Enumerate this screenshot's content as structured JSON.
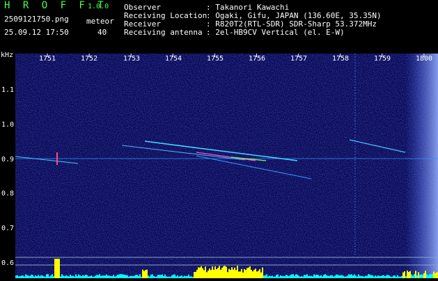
{
  "app": {
    "title": "H R O F F T",
    "version": "1.0.0",
    "filename": "2509121750.png",
    "datetime": "25.09.12 17:50",
    "meteor_label": "meteor",
    "meteor_count": "40"
  },
  "info": {
    "rows": [
      {
        "label": "Observer",
        "value": ": Takanori Kawachi"
      },
      {
        "label": "Receiving Location",
        "value": ": Ogaki, Gifu, JAPAN (136.60E, 35.35N)"
      },
      {
        "label": "Receiver",
        "value": ": R820T2(RTL-SDR) SDR-Sharp 53.372MHz"
      },
      {
        "label": "Receiving antenna",
        "value": ": 2el-HB9CV Vertical (el. E-W)"
      }
    ]
  },
  "axis": {
    "y_unit": "kHz",
    "x_ticks": [
      "1751",
      "1752",
      "1753",
      "1754",
      "1755",
      "1756",
      "1757",
      "1758",
      "1759",
      "1800"
    ],
    "y_ticks": [
      "1.1",
      "1.0",
      "0.9",
      "0.8",
      "0.7",
      "0.6"
    ]
  },
  "colors": {
    "background": "#0a0a50",
    "text": "#4cff4c",
    "trace": "#ffff00",
    "baseline": "#00ffff"
  }
}
